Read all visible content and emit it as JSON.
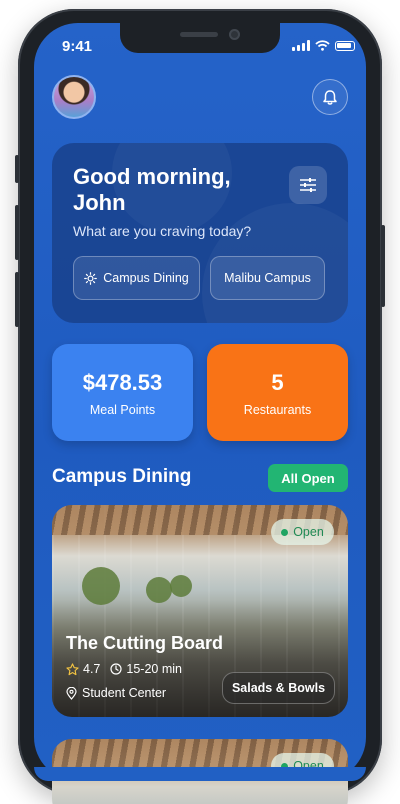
{
  "status_bar": {
    "time": "9:41"
  },
  "header": {
    "avatar_icon": "user-avatar",
    "bell_icon": "bell-icon"
  },
  "greeting": {
    "title": "Good morning, John",
    "subtitle": "What are you craving today?",
    "chips": [
      {
        "label": "Campus Dining",
        "icon": "sun-icon"
      },
      {
        "label": "Malibu Campus"
      }
    ]
  },
  "stats": [
    {
      "value": "$478.53",
      "label": "Meal Points",
      "color": "#3b82f0"
    },
    {
      "value": "5",
      "label": "Restaurants",
      "color": "#f97316"
    }
  ],
  "section": {
    "title": "Campus Dining",
    "badge": "All Open",
    "badge_color": "#22b573"
  },
  "restaurants": [
    {
      "name": "The Cutting Board",
      "status": "Open",
      "rating": "4.7",
      "time": "15-20 min",
      "location": "Student Center",
      "category": "Salads & Bowls"
    },
    {
      "status": "Open"
    }
  ],
  "colors": {
    "background": "#2563c9",
    "open_green": "#1fa463"
  }
}
